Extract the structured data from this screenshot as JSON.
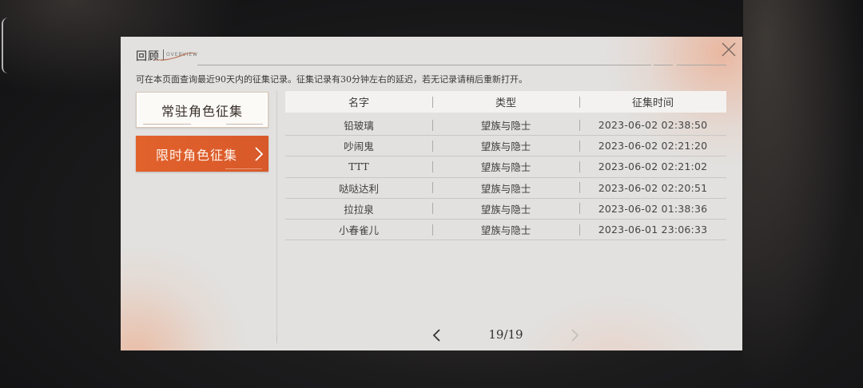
{
  "header": {
    "title": "回顾",
    "subtitle": "OVERVIEW"
  },
  "notice": "可在本页面查询最近90天内的征集记录。征集记录有30分钟左右的延迟，若无记录请稍后重新打开。",
  "sidebar": {
    "buttons": [
      {
        "label": "常驻角色征集",
        "selected": false
      },
      {
        "label": "限时角色征集",
        "selected": true
      }
    ]
  },
  "table": {
    "headers": [
      "名字",
      "类型",
      "征集时间"
    ],
    "rows": [
      {
        "name": "铅玻璃",
        "type": "望族与隐士",
        "time": "2023-06-02 02:38:50"
      },
      {
        "name": "吵闹鬼",
        "type": "望族与隐士",
        "time": "2023-06-02 02:21:20"
      },
      {
        "name": "TTT",
        "type": "望族与隐士",
        "time": "2023-06-02 02:21:02"
      },
      {
        "name": "哒哒达利",
        "type": "望族与隐士",
        "time": "2023-06-02 02:20:51"
      },
      {
        "name": "拉拉泉",
        "type": "望族与隐士",
        "time": "2023-06-02 01:38:36"
      },
      {
        "name": "小春雀儿",
        "type": "望族与隐士",
        "time": "2023-06-01 23:06:33"
      }
    ]
  },
  "pager": {
    "text": "19/19",
    "prev_icon": "chevron-left-icon",
    "next_icon": "chevron-right-icon",
    "next_enabled": false
  },
  "colors": {
    "accent": "#e0602b",
    "panel": "#e2e1df"
  }
}
